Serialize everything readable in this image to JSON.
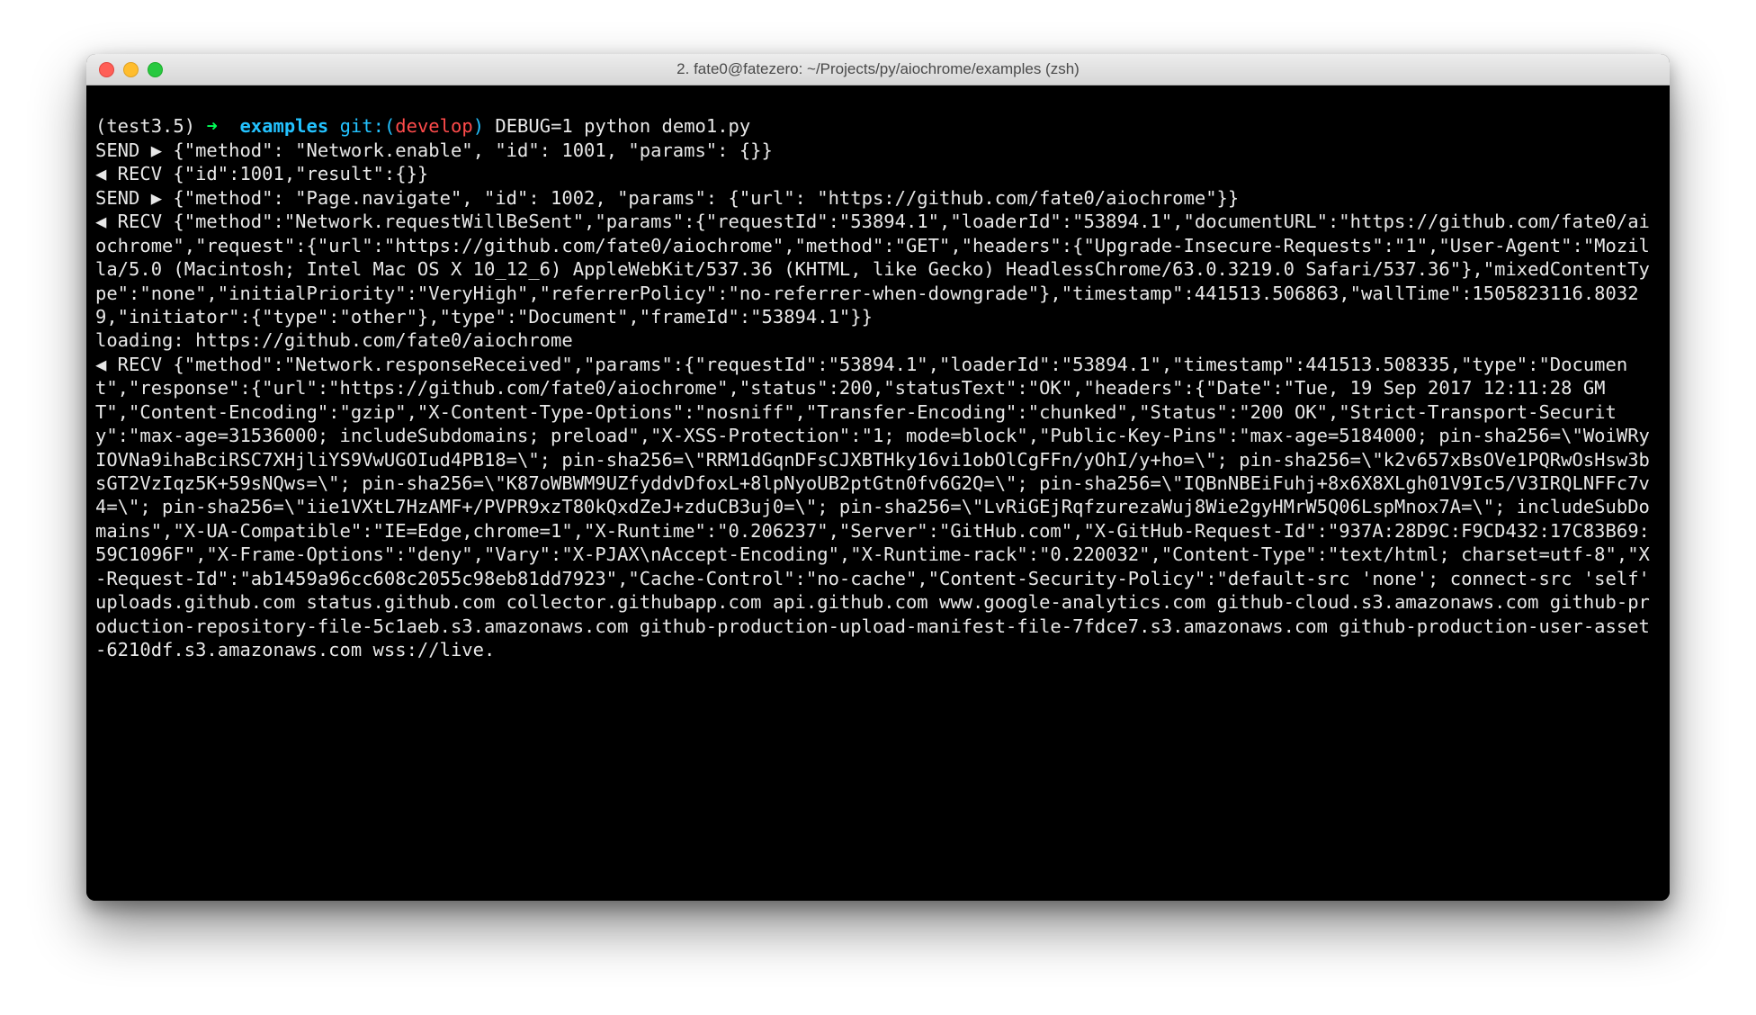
{
  "window": {
    "title": "2. fate0@fatezero: ~/Projects/py/aiochrome/examples (zsh)"
  },
  "prompt": {
    "venv": "(test3.5)",
    "arrow": "➜",
    "cwd": "examples",
    "git_label": "git:",
    "paren_open": "(",
    "branch": "develop",
    "paren_close": ")",
    "command": "DEBUG=1 python demo1.py"
  },
  "output": "SEND ▶ {\"method\": \"Network.enable\", \"id\": 1001, \"params\": {}}\n◀ RECV {\"id\":1001,\"result\":{}}\nSEND ▶ {\"method\": \"Page.navigate\", \"id\": 1002, \"params\": {\"url\": \"https://github.com/fate0/aiochrome\"}}\n◀ RECV {\"method\":\"Network.requestWillBeSent\",\"params\":{\"requestId\":\"53894.1\",\"loaderId\":\"53894.1\",\"documentURL\":\"https://github.com/fate0/aiochrome\",\"request\":{\"url\":\"https://github.com/fate0/aiochrome\",\"method\":\"GET\",\"headers\":{\"Upgrade-Insecure-Requests\":\"1\",\"User-Agent\":\"Mozilla/5.0 (Macintosh; Intel Mac OS X 10_12_6) AppleWebKit/537.36 (KHTML, like Gecko) HeadlessChrome/63.0.3219.0 Safari/537.36\"},\"mixedContentType\":\"none\",\"initialPriority\":\"VeryHigh\",\"referrerPolicy\":\"no-referrer-when-downgrade\"},\"timestamp\":441513.506863,\"wallTime\":1505823116.80329,\"initiator\":{\"type\":\"other\"},\"type\":\"Document\",\"frameId\":\"53894.1\"}}\nloading: https://github.com/fate0/aiochrome\n◀ RECV {\"method\":\"Network.responseReceived\",\"params\":{\"requestId\":\"53894.1\",\"loaderId\":\"53894.1\",\"timestamp\":441513.508335,\"type\":\"Document\",\"response\":{\"url\":\"https://github.com/fate0/aiochrome\",\"status\":200,\"statusText\":\"OK\",\"headers\":{\"Date\":\"Tue, 19 Sep 2017 12:11:28 GMT\",\"Content-Encoding\":\"gzip\",\"X-Content-Type-Options\":\"nosniff\",\"Transfer-Encoding\":\"chunked\",\"Status\":\"200 OK\",\"Strict-Transport-Security\":\"max-age=31536000; includeSubdomains; preload\",\"X-XSS-Protection\":\"1; mode=block\",\"Public-Key-Pins\":\"max-age=5184000; pin-sha256=\\\"WoiWRyIOVNa9ihaBciRSC7XHjliYS9VwUGOIud4PB18=\\\"; pin-sha256=\\\"RRM1dGqnDFsCJXBTHky16vi1obOlCgFFn/yOhI/y+ho=\\\"; pin-sha256=\\\"k2v657xBsOVe1PQRwOsHsw3bsGT2VzIqz5K+59sNQws=\\\"; pin-sha256=\\\"K87oWBWM9UZfyddvDfoxL+8lpNyoUB2ptGtn0fv6G2Q=\\\"; pin-sha256=\\\"IQBnNBEiFuhj+8x6X8XLgh01V9Ic5/V3IRQLNFFc7v4=\\\"; pin-sha256=\\\"iie1VXtL7HzAMF+/PVPR9xzT80kQxdZeJ+zduCB3uj0=\\\"; pin-sha256=\\\"LvRiGEjRqfzurezaWuj8Wie2gyHMrW5Q06LspMnox7A=\\\"; includeSubDomains\",\"X-UA-Compatible\":\"IE=Edge,chrome=1\",\"X-Runtime\":\"0.206237\",\"Server\":\"GitHub.com\",\"X-GitHub-Request-Id\":\"937A:28D9C:F9CD432:17C83B69:59C1096F\",\"X-Frame-Options\":\"deny\",\"Vary\":\"X-PJAX\\nAccept-Encoding\",\"X-Runtime-rack\":\"0.220032\",\"Content-Type\":\"text/html; charset=utf-8\",\"X-Request-Id\":\"ab1459a96cc608c2055c98eb81dd7923\",\"Cache-Control\":\"no-cache\",\"Content-Security-Policy\":\"default-src 'none'; connect-src 'self' uploads.github.com status.github.com collector.githubapp.com api.github.com www.google-analytics.com github-cloud.s3.amazonaws.com github-production-repository-file-5c1aeb.s3.amazonaws.com github-production-upload-manifest-file-7fdce7.s3.amazonaws.com github-production-user-asset-6210df.s3.amazonaws.com wss://live."
}
